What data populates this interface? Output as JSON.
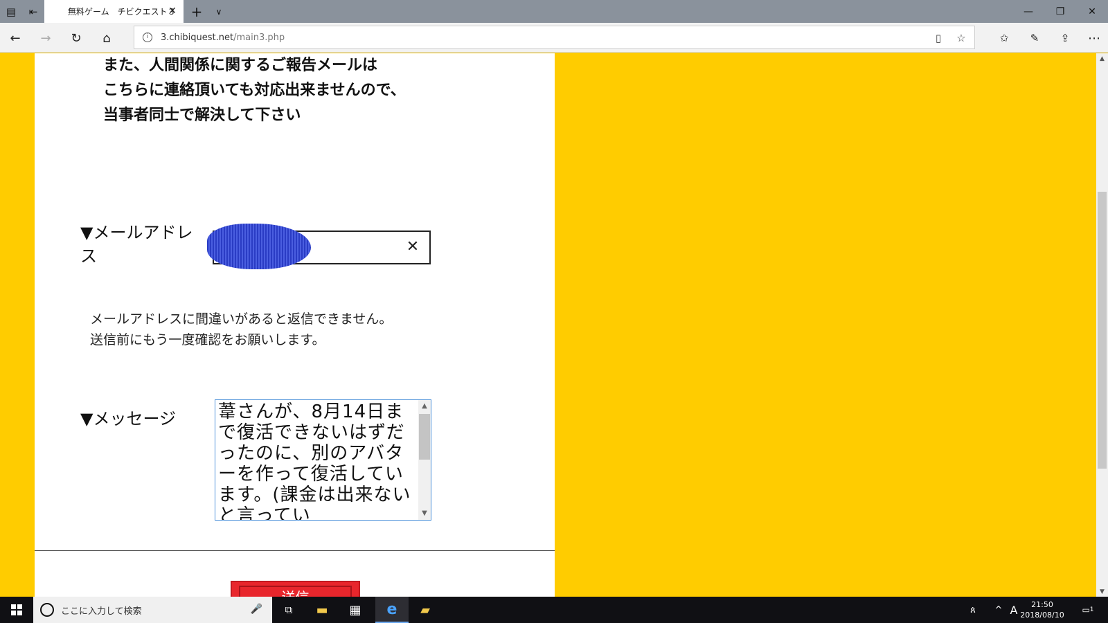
{
  "browser": {
    "tab_title": "無料ゲーム　チビクエスト３",
    "url_host": "3.chibiquest.net",
    "url_path": "/main3.php"
  },
  "page": {
    "notice_lines": [
      "また、人間関係に関するご報告メールは",
      "こちらに連絡頂いても対応出来ませんので、",
      "当事者同士で解決して下さい"
    ],
    "email_label_line1": "▼メールアドレ",
    "email_label_line2": "ス",
    "email_clear_icon": "✕",
    "help_lines": [
      "メールアドレスに間違いがあると返信できません。",
      "送信前にもう一度確認をお願いします。"
    ],
    "message_label": "▼メッセージ",
    "message_text": "葦さんが、8月14日まで復活できないはずだったのに、別のアバターを作って復活しています。(課金は出来ないと言ってい",
    "send_label": "送信"
  },
  "taskbar": {
    "search_placeholder": "ここに入力して検索",
    "ime": "A",
    "time": "21:50",
    "date": "2018/08/10",
    "notification_count": "1"
  },
  "colors": {
    "page_bg": "#ffcc00",
    "send_button": "#e8262c",
    "titlebar": "#8a929c"
  }
}
